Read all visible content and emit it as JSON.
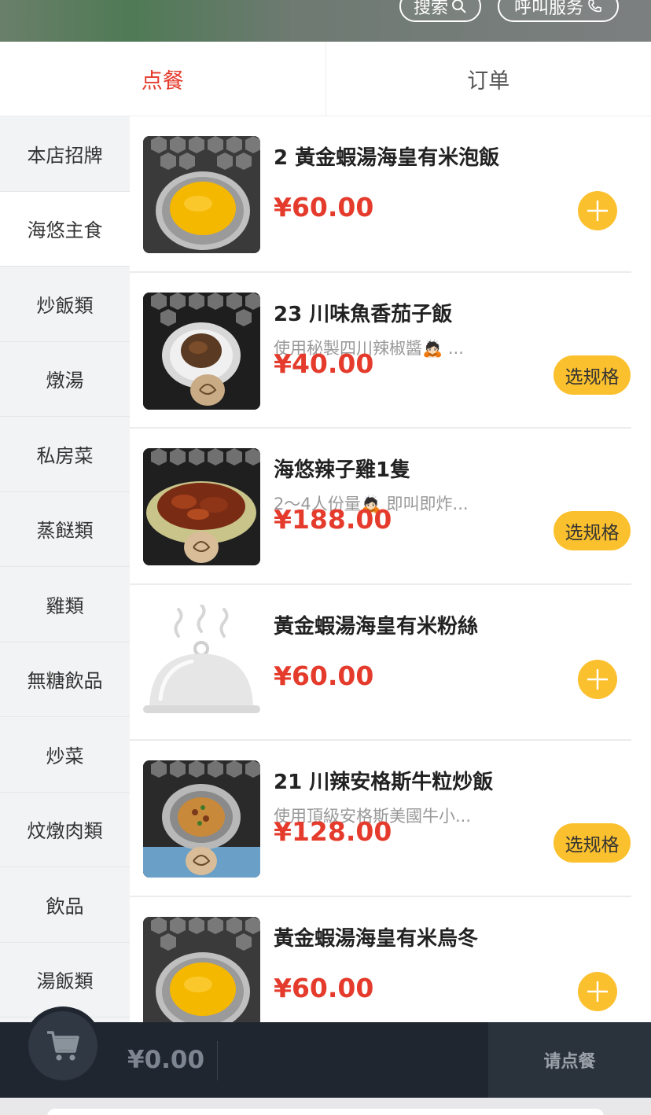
{
  "header": {
    "search_label": "搜索",
    "call_label": "呼叫服务"
  },
  "tabs": [
    {
      "label": "点餐",
      "active": true
    },
    {
      "label": "订单",
      "active": false
    }
  ],
  "sidebar": {
    "items": [
      {
        "label": "本店招牌"
      },
      {
        "label": "海悠主食",
        "active": true
      },
      {
        "label": "炒飯類"
      },
      {
        "label": "燉湯"
      },
      {
        "label": "私房菜"
      },
      {
        "label": "蒸餸類"
      },
      {
        "label": "雞類"
      },
      {
        "label": "無糖飲品"
      },
      {
        "label": "炒菜"
      },
      {
        "label": "炆燉肉類"
      },
      {
        "label": "飲品"
      },
      {
        "label": "湯飯類"
      }
    ]
  },
  "products": [
    {
      "name": "2 黃金蝦湯海皇有米泡飯",
      "desc": "",
      "price": "¥60.00",
      "action": "add",
      "image": "golden-soup-rice-photo"
    },
    {
      "name": "23 川味魚香茄子飯",
      "desc": "使用秘製四川辣椒醬🙇🏻 ...",
      "price": "¥40.00",
      "action": "spec",
      "spec_label": "选规格",
      "image": "eggplant-rice-photo"
    },
    {
      "name": "海悠辣子雞1隻",
      "desc": "2～4人份量🙇🏻 即叫即炸...",
      "price": "¥188.00",
      "action": "spec",
      "spec_label": "选规格",
      "image": "spicy-chicken-photo"
    },
    {
      "name": "黃金蝦湯海皇有米粉絲",
      "desc": "",
      "price": "¥60.00",
      "action": "add",
      "image": "placeholder-cloche"
    },
    {
      "name": "21 川辣安格斯牛粒炒飯",
      "desc": "使用頂級安格斯美國牛小...",
      "price": "¥128.00",
      "action": "spec",
      "spec_label": "选规格",
      "image": "beef-fried-rice-photo"
    },
    {
      "name": "黃金蝦湯海皇有米烏冬",
      "desc": "",
      "price": "¥60.00",
      "action": "add",
      "image": "golden-soup-udon-photo"
    }
  ],
  "cart": {
    "total": "¥0.00",
    "checkout_label": "请点餐"
  },
  "colors": {
    "accent_red": "#e53b2c",
    "button_yellow": "#fbc02d",
    "bottom_bar": "#1f2630"
  }
}
